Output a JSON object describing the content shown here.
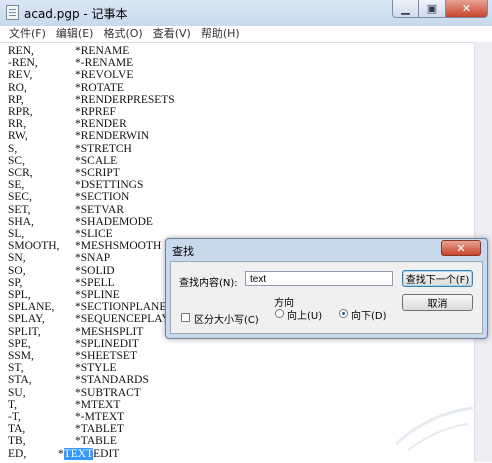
{
  "window": {
    "title": "acad.pgp - 记事本",
    "controls": {
      "minimize_icon": "minimize-icon",
      "maximize_icon": "restore-icon",
      "close_icon": "close-icon"
    }
  },
  "menu": [
    "文件(F)",
    "编辑(E)",
    "格式(O)",
    "查看(V)",
    "帮助(H)"
  ],
  "lines": [
    [
      "REN,",
      "*RENAME"
    ],
    [
      "-REN,",
      "*-RENAME"
    ],
    [
      "REV,",
      "*REVOLVE"
    ],
    [
      "RO,",
      "*ROTATE"
    ],
    [
      "RP,",
      "*RENDERPRESETS"
    ],
    [
      "RPR,",
      "*RPREF"
    ],
    [
      "RR,",
      "*RENDER"
    ],
    [
      "RW,",
      "*RENDERWIN"
    ],
    [
      "S,",
      "*STRETCH"
    ],
    [
      "SC,",
      "*SCALE"
    ],
    [
      "SCR,",
      "*SCRIPT"
    ],
    [
      "SE,",
      "*DSETTINGS"
    ],
    [
      "SEC,",
      "*SECTION"
    ],
    [
      "SET,",
      "*SETVAR"
    ],
    [
      "SHA,",
      "*SHADEMODE"
    ],
    [
      "SL,",
      "*SLICE"
    ],
    [
      "SMOOTH,",
      "*MESHSMOOTH"
    ],
    [
      "SN,",
      "*SNAP"
    ],
    [
      "SO,",
      "*SOLID"
    ],
    [
      "SP,",
      "*SPELL"
    ],
    [
      "SPL,",
      "*SPLINE"
    ],
    [
      "SPLANE,",
      "*SECTIONPLANE"
    ],
    [
      "SPLAY,",
      "*SEQUENCEPLAY"
    ],
    [
      "SPLIT,",
      "*MESHSPLIT"
    ],
    [
      "SPE,",
      "*SPLINEDIT"
    ],
    [
      "SSM,",
      "*SHEETSET"
    ],
    [
      "ST,",
      "*STYLE"
    ],
    [
      "STA,",
      "*STANDARDS"
    ],
    [
      "SU,",
      "*SUBTRACT"
    ],
    [
      "T,",
      "*MTEXT"
    ],
    [
      "-T,",
      "*-MTEXT"
    ],
    [
      "TA,",
      "*TABLET"
    ],
    [
      "TB,",
      "*TABLE"
    ]
  ],
  "last_line": {
    "key": "ED,",
    "prefix": "*",
    "selected": "TEXT",
    "suffix": "EDIT"
  },
  "find_dialog": {
    "title": "查找",
    "find_label": "查找内容(N):",
    "find_value": "text",
    "find_next_label": "查找下一个(F)",
    "cancel_label": "取消",
    "direction_label": "方向",
    "up_label": "向上(U)",
    "down_label": "向下(D)",
    "direction_selected": "down",
    "match_case_label": "区分大小写(C)",
    "match_case_checked": false
  }
}
